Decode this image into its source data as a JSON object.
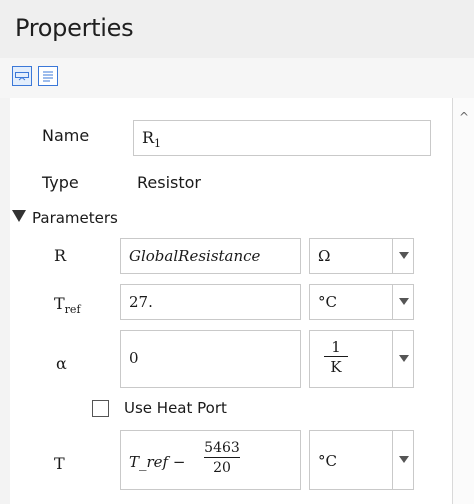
{
  "panel": {
    "title": "Properties"
  },
  "toolbar": {
    "buttons": [
      "property-view-icon",
      "text-view-icon"
    ]
  },
  "props": {
    "name_label": "Name",
    "name_value_base": "R",
    "name_value_sub": "1",
    "type_label": "Type",
    "type_value": "Resistor"
  },
  "params": {
    "header": "Parameters",
    "rows": [
      {
        "label": "R",
        "value": "GlobalResistance",
        "unit": "Ω"
      },
      {
        "label_base": "T",
        "label_sub": "ref",
        "value": "27.",
        "unit": "°C"
      },
      {
        "label": "α",
        "value": "0",
        "unit_num": "1",
        "unit_den": "K"
      },
      {
        "label": "T",
        "value_expr": "T_ref −",
        "value_num": "5463",
        "value_den": "20",
        "unit": "°C"
      }
    ],
    "heat_port_label": "Use Heat Port",
    "heat_port_checked": false
  }
}
